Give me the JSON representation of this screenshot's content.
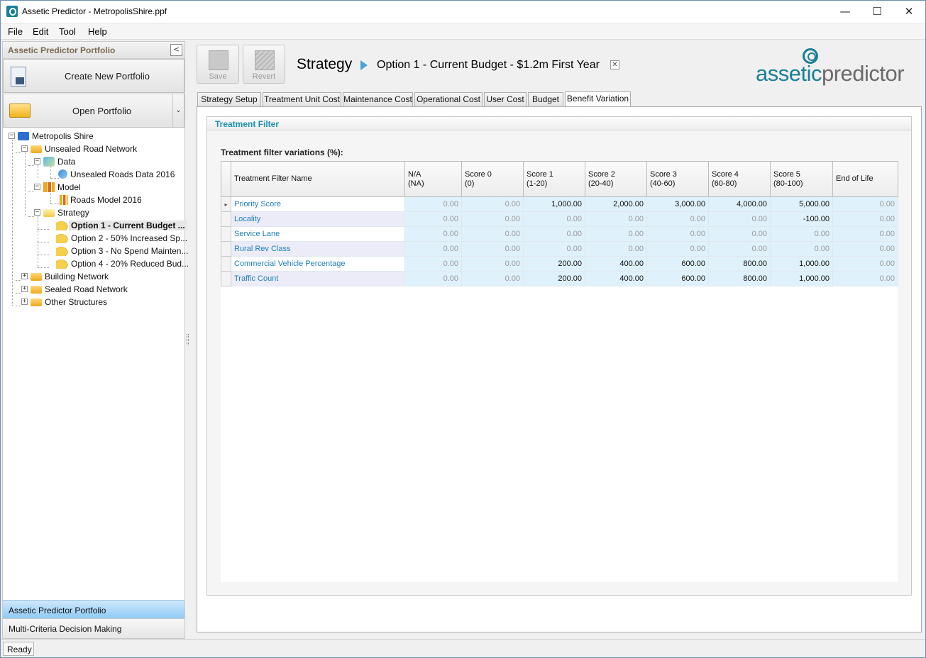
{
  "window": {
    "title": "Assetic Predictor - MetropolisShire.ppf",
    "minimize": "—",
    "maximize": "☐",
    "close": "✕"
  },
  "menu": {
    "file": "File",
    "edit": "Edit",
    "tool": "Tool",
    "help": "Help"
  },
  "sidebar": {
    "header": "Assetic Predictor Portfolio",
    "collapse_glyph": "<",
    "create_label": "Create New Portfolio",
    "open_label": "Open Portfolio",
    "open_arrow": "⌄",
    "tree": {
      "root": "Metropolis Shire",
      "unsealed": "Unsealed Road Network",
      "data": "Data",
      "data_item": "Unsealed Roads Data 2016",
      "model": "Model",
      "model_item": "Roads Model 2016",
      "strategy": "Strategy",
      "options": [
        "Option 1 - Current Budget ...",
        "Option 2 - 50% Increased Sp...",
        "Option 3 -  No Spend Mainten...",
        "Option 4 - 20% Reduced Bud..."
      ],
      "building": "Building Network",
      "sealed": "Sealed Road Network",
      "other": "Other Structures"
    },
    "footer_active": "Assetic Predictor Portfolio",
    "footer_mcdm": "Multi-Criteria Decision Making"
  },
  "toolbar": {
    "save_label": "Save",
    "revert_label": "Revert"
  },
  "header": {
    "section": "Strategy",
    "option": "Option 1 - Current Budget - $1.2m First Year",
    "close_glyph": "✕",
    "logo_bold": "assetic",
    "logo_thin": "predictor"
  },
  "tabs": [
    "Strategy Setup",
    "Treatment Unit Cost",
    "Maintenance Cost",
    "Operational Cost",
    "User Cost",
    "Budget",
    "Benefit Variation"
  ],
  "filter": {
    "title": "Treatment Filter",
    "subtitle": "Treatment filter variations (%):",
    "columns": {
      "name": "Treatment Filter Name",
      "na": [
        "N/A",
        "(NA)"
      ],
      "s0": [
        "Score 0",
        "(0)"
      ],
      "s1": [
        "Score 1",
        "(1-20)"
      ],
      "s2": [
        "Score 2",
        "(20-40)"
      ],
      "s3": [
        "Score 3",
        "(40-60)"
      ],
      "s4": [
        "Score 4",
        "(60-80)"
      ],
      "s5": [
        "Score 5",
        "(80-100)"
      ],
      "eol": "End of Life"
    },
    "rows": [
      {
        "name": "Priority Score",
        "v": [
          "0.00",
          "0.00",
          "1,000.00",
          "2,000.00",
          "3,000.00",
          "4,000.00",
          "5,000.00",
          "0.00"
        ]
      },
      {
        "name": "Locality",
        "v": [
          "0.00",
          "0.00",
          "0.00",
          "0.00",
          "0.00",
          "0.00",
          "-100.00",
          "0.00"
        ]
      },
      {
        "name": "Service Lane",
        "v": [
          "0.00",
          "0.00",
          "0.00",
          "0.00",
          "0.00",
          "0.00",
          "0.00",
          "0.00"
        ]
      },
      {
        "name": "Rural Rev Class",
        "v": [
          "0.00",
          "0.00",
          "0.00",
          "0.00",
          "0.00",
          "0.00",
          "0.00",
          "0.00"
        ]
      },
      {
        "name": "Commercial Vehicle Percentage",
        "v": [
          "0.00",
          "0.00",
          "200.00",
          "400.00",
          "600.00",
          "800.00",
          "1,000.00",
          "0.00"
        ]
      },
      {
        "name": "Traffic Count",
        "v": [
          "0.00",
          "0.00",
          "200.00",
          "400.00",
          "600.00",
          "800.00",
          "1,000.00",
          "0.00"
        ]
      }
    ],
    "row_indicator": "▸"
  },
  "status": {
    "text": "Ready"
  }
}
